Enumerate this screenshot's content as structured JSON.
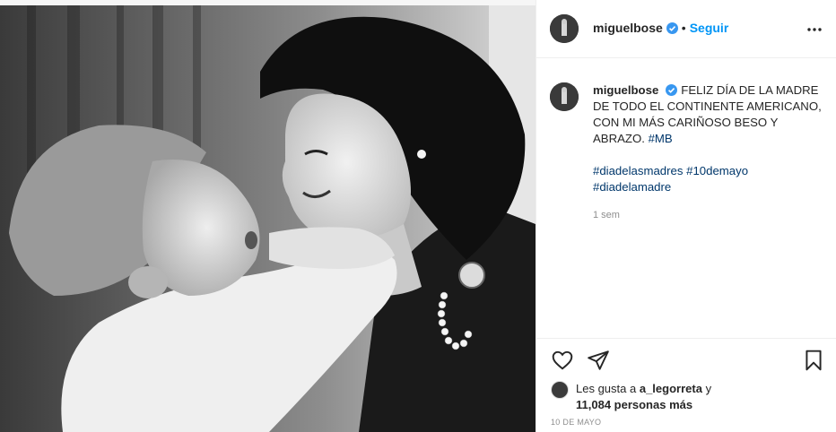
{
  "post": {
    "username": "miguelbose",
    "follow_label": "Seguir",
    "separator": "•",
    "caption": {
      "username": "miguelbose",
      "text": "FELIZ DÍA DE LA MADRE DE TODO EL CONTINENTE AMERICANO, CON MI MÁS CARIÑOSO BESO Y ABRAZO.",
      "tag_mb": "#MB",
      "hashtags": [
        "#diadelasmadres",
        "#10demayo",
        "#diadelamadre"
      ],
      "time": "1 sem"
    },
    "likes": {
      "prefix": "Les gusta a",
      "user": "a_legorreta",
      "conjunction": "y",
      "count_text": "11,084 personas más"
    },
    "date": "10 DE MAYO"
  },
  "icons": {
    "verified": "verified-badge-icon",
    "more": "more-options-icon",
    "like": "heart-icon",
    "share": "paper-plane-icon",
    "save": "bookmark-icon"
  },
  "colors": {
    "accent": "#0095f6",
    "hashtag": "#00376b",
    "muted": "#8e8e8e",
    "text": "#262626"
  }
}
